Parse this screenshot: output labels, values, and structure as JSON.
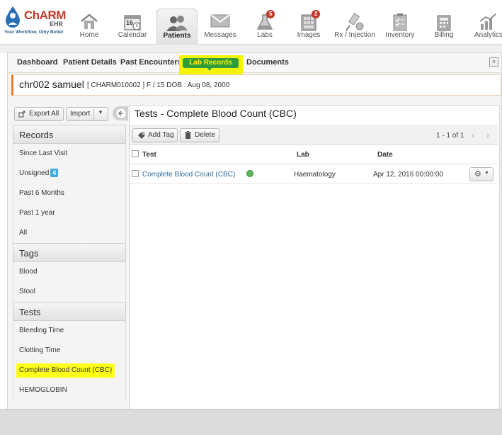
{
  "logo": {
    "brand": "ChARM",
    "brand_sub": "EHR",
    "tagline": "Your Workflow, Only Better"
  },
  "nav": {
    "home": "Home",
    "calendar": "Calendar",
    "calendar_day": "16",
    "patients": "Patients",
    "messages": "Messages",
    "labs": "Labs",
    "labs_badge": "5",
    "images": "Images",
    "images_badge": "2",
    "rx": "Rx / Injection",
    "inventory": "Inventory",
    "billing": "Billing",
    "analytics": "Analytics"
  },
  "subtabs": {
    "dashboard": "Dashboard",
    "patient_details": "Patient Details",
    "past_encounters": "Past Encounters",
    "lab_records": "Lab Records",
    "documents": "Documents",
    "close": "×"
  },
  "patient": {
    "name": "chr002 samuel",
    "info": "[ CHARM010002 ]   F / 15   DOB : Aug 08, 2000"
  },
  "left": {
    "export_label": "Export All",
    "import_label": "Import",
    "records_header": "Records",
    "records": [
      "Since Last Visit",
      "Unsigned",
      "Past 6 Months",
      "Past 1 year",
      "All"
    ],
    "unsigned_count": "4",
    "tags_header": "Tags",
    "tags": [
      "Blood",
      "Stool"
    ],
    "tests_header": "Tests",
    "tests": [
      "Bleeding Time",
      "Clotting Time",
      "Complete Blood Count (CBC)",
      "HEMOGLOBIN"
    ]
  },
  "right": {
    "title": "Tests  - Complete Blood Count (CBC)",
    "add_tag_label": "Add Tag",
    "delete_label": "Delete",
    "pager": "1 - 1 of 1",
    "columns": {
      "test": "Test",
      "lab": "Lab",
      "date": "Date"
    },
    "rows": [
      {
        "test": "Complete Blood Count (CBC)",
        "lab": "Haematology",
        "date": "Apr 12, 2016 00:00:00"
      }
    ]
  },
  "colors": {
    "accent": "#2f9d3c",
    "highlight": "#ffff1a",
    "brand": "#c0392b",
    "badge": "#3fa9e0"
  }
}
